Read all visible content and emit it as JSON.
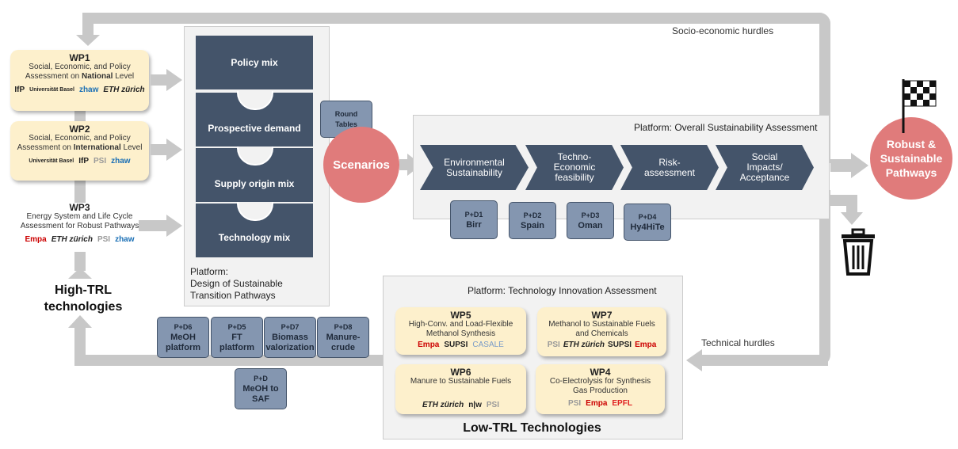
{
  "loops": {
    "socio_label": "Socio-economic hurdles",
    "technical_label": "Technical hurdles"
  },
  "wp1": {
    "title": "WP1",
    "line1": "Social, Economic, and Policy",
    "line2_pre": "Assessment on ",
    "line2_bold": "National",
    "line2_post": " Level",
    "logos": [
      "IfP",
      "Universität Basel",
      "zhaw",
      "ETH zürich"
    ]
  },
  "wp2": {
    "title": "WP2",
    "line1": "Social, Economic, and Policy",
    "line2_pre": "Assessment on ",
    "line2_bold": "International",
    "line2_post": " Level",
    "logos": [
      "Universität Basel",
      "IfP",
      "PSI",
      "zhaw"
    ]
  },
  "wp3": {
    "title": "WP3",
    "line1": "Energy System and Life Cycle",
    "line2": "Assessment for Robust Pathways",
    "logos": [
      "Empa",
      "ETH zürich",
      "PSI",
      "zhaw"
    ]
  },
  "high_trl": {
    "line1": "High-TRL",
    "line2": "technologies"
  },
  "design_platform": {
    "pieces": [
      "Policy mix",
      "Prospective demand",
      "Supply origin mix",
      "Technology mix"
    ],
    "label_line1": "Platform:",
    "label_line2": "Design of Sustainable",
    "label_line3": "Transition Pathways"
  },
  "round_tables": {
    "line1": "Round",
    "line2": "Tables"
  },
  "scenarios": "Scenarios",
  "overall": {
    "title": "Platform: Overall Sustainability Assessment",
    "steps": [
      [
        "Environmental",
        "Sustainability"
      ],
      [
        "Techno-",
        "Economic",
        "feasibility"
      ],
      [
        "Risk-",
        "assessment"
      ],
      [
        "Social",
        "Impacts/",
        "Acceptance"
      ]
    ]
  },
  "pd_top": [
    {
      "id": "P+D1",
      "name": "Birr"
    },
    {
      "id": "P+D2",
      "name": "Spain"
    },
    {
      "id": "P+D3",
      "name": "Oman"
    },
    {
      "id": "P+D4",
      "name": "Hy4HiTe"
    }
  ],
  "robust": {
    "line1": "Robust &",
    "line2": "Sustainable",
    "line3": "Pathways"
  },
  "pd_bottom": [
    {
      "id": "P+D6",
      "l1": "MeOH",
      "l2": "platform"
    },
    {
      "id": "P+D5",
      "l1": "FT",
      "l2": "platform"
    },
    {
      "id": "P+D7",
      "l1": "Biomass",
      "l2": "valorization"
    },
    {
      "id": "P+D8",
      "l1": "Manure-",
      "l2": "crude"
    },
    {
      "id": "P+D",
      "l1": "MeOH to",
      "l2": "SAF"
    }
  ],
  "tech_platform": {
    "title": "Platform: Technology Innovation Assessment",
    "footer": "Low-TRL Technologies",
    "wp5": {
      "title": "WP5",
      "l1": "High-Conv. and Load-Flexible",
      "l2": "Methanol Synthesis",
      "logos": [
        "Empa",
        "SUPSI",
        "CASALE"
      ]
    },
    "wp7": {
      "title": "WP7",
      "l1": "Methanol to Sustainable Fuels",
      "l2": "and Chemicals",
      "logos": [
        "PSI",
        "ETH zürich",
        "SUPSI",
        "Empa"
      ]
    },
    "wp6": {
      "title": "WP6",
      "l1": "Manure to Sustainable Fuels",
      "l2": "",
      "logos": [
        "ETH zürich",
        "n|w",
        "PSI"
      ]
    },
    "wp4": {
      "title": "WP4",
      "l1": "Co-Electrolysis for Synthesis",
      "l2": "Gas Production",
      "logos": [
        "PSI",
        "Empa",
        "EPFL"
      ]
    }
  },
  "colors": {
    "navy": "#44546a",
    "pd": "#8496b0",
    "wp": "#fdf0cc",
    "circle": "#e07b7b",
    "arrow": "#c8c8c8"
  }
}
